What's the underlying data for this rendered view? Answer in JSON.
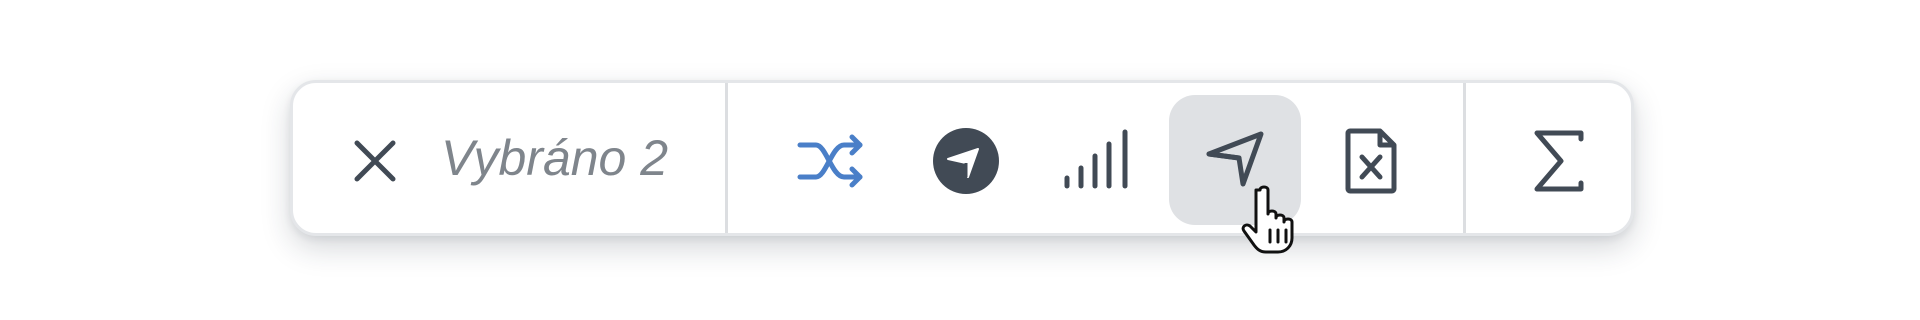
{
  "selection_bar": {
    "selected_text": "Vybráno 2",
    "active_button": "send",
    "icons": {
      "close": "close-icon",
      "shuffle": "shuffle-icon",
      "navigate_circle": "navigation-circle-icon",
      "signal": "signal-bars-icon",
      "send": "send-arrow-icon",
      "delete_file": "file-x-icon",
      "sum": "sigma-icon",
      "cursor": "hand-pointer-icon"
    },
    "colors": {
      "icon": "#414a55",
      "accent": "#4a7fc8",
      "active_background": "#dfe1e4",
      "label": "#7f858c"
    }
  }
}
